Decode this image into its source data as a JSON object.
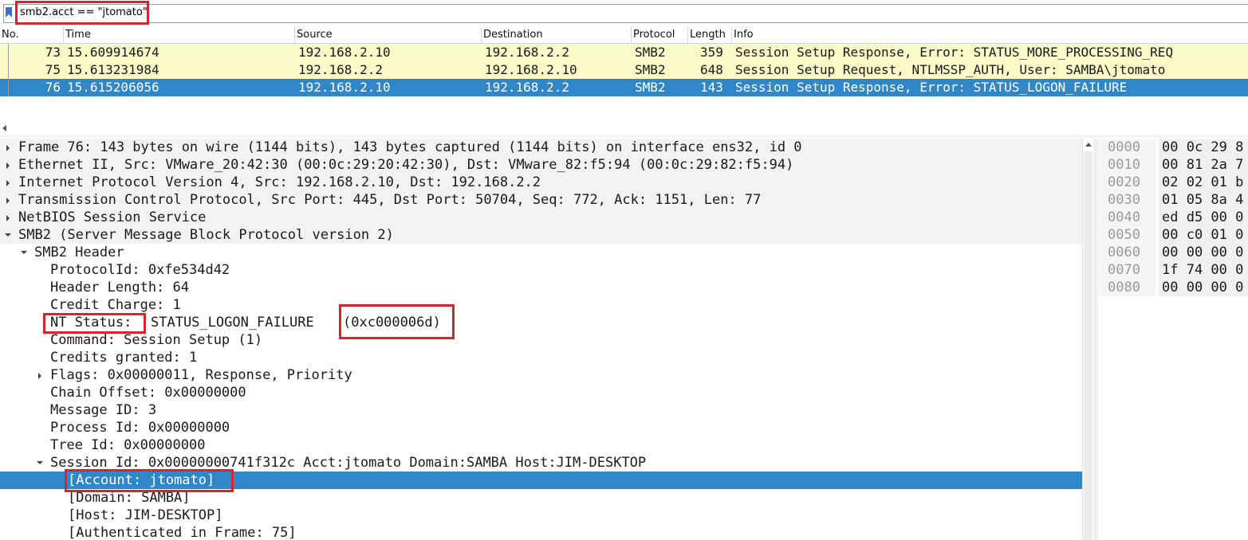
{
  "filter": {
    "value": "smb2.acct == \"jtomato\"",
    "icon": "bookmark-icon",
    "accent": "#3d6fd1"
  },
  "packet_list": {
    "columns": [
      "No.",
      "Time",
      "Source",
      "Destination",
      "Protocol",
      "Length",
      "Info"
    ],
    "rows": [
      {
        "no": "73",
        "time": "15.609914674",
        "source": "192.168.2.10",
        "destination": "192.168.2.2",
        "protocol": "SMB2",
        "length": "359",
        "info": "Session Setup Response, Error: STATUS_MORE_PROCESSING_REQ"
      },
      {
        "no": "75",
        "time": "15.613231984",
        "source": "192.168.2.2",
        "destination": "192.168.2.10",
        "protocol": "SMB2",
        "length": "648",
        "info": "Session Setup Request, NTLMSSP_AUTH, User: SAMBA\\jtomato"
      },
      {
        "no": "76",
        "time": "15.615206056",
        "source": "192.168.2.10",
        "destination": "192.168.2.2",
        "protocol": "SMB2",
        "length": "143",
        "info": "Session Setup Response, Error: STATUS_LOGON_FAILURE"
      }
    ]
  },
  "details": {
    "frame": "Frame 76: 143 bytes on wire (1144 bits), 143 bytes captured (1144 bits) on interface ens32, id 0",
    "ethernet": "Ethernet II, Src: VMware_20:42:30 (00:0c:29:20:42:30), Dst: VMware_82:f5:94 (00:0c:29:82:f5:94)",
    "ip": "Internet Protocol Version 4, Src: 192.168.2.10, Dst: 192.168.2.2",
    "tcp": "Transmission Control Protocol, Src Port: 445, Dst Port: 50704, Seq: 772, Ack: 1151, Len: 77",
    "netbios": "NetBIOS Session Service",
    "smb2": "SMB2 (Server Message Block Protocol version 2)",
    "smb2_header": "SMB2 Header",
    "protocol_id": "ProtocolId: 0xfe534d42",
    "header_length": "Header Length: 64",
    "credit_charge": "Credit Charge: 1",
    "nt_status_label": "NT Status:",
    "nt_status_value": "STATUS_LOGON_FAILURE",
    "nt_status_code": "(0xc000006d)",
    "command": "Command: Session Setup (1)",
    "credits_granted": "Credits granted: 1",
    "flags": "Flags: 0x00000011, Response, Priority",
    "chain_offset": "Chain Offset: 0x00000000",
    "message_id": "Message ID: 3",
    "process_id": "Process Id: 0x00000000",
    "tree_id": "Tree Id: 0x00000000",
    "session_id": "Session Id: 0x00000000741f312c Acct:jtomato Domain:SAMBA Host:JIM-DESKTOP",
    "account": "[Account: jtomato]",
    "domain": "[Domain: SAMBA]",
    "host": "[Host: JIM-DESKTOP]",
    "auth_frame": "[Authenticated in Frame: 75]"
  },
  "hex": {
    "rows": [
      {
        "offset": "0000",
        "bytes": "00 0c 29 8"
      },
      {
        "offset": "0010",
        "bytes": "00 81 2a 7"
      },
      {
        "offset": "0020",
        "bytes": "02 02 01 b"
      },
      {
        "offset": "0030",
        "bytes": "01 05 8a 4"
      },
      {
        "offset": "0040",
        "bytes": "ed d5 00 0"
      },
      {
        "offset": "0050",
        "bytes": "00 c0 01 0"
      },
      {
        "offset": "0060",
        "bytes": "00 00 00 0"
      },
      {
        "offset": "0070",
        "bytes": "1f 74 00 0"
      },
      {
        "offset": "0080",
        "bytes": "00 00 00 0"
      }
    ]
  },
  "colors": {
    "highlight": "#d9232e",
    "selection": "#2f87c8",
    "row_yellow": "#fbfbc7"
  }
}
